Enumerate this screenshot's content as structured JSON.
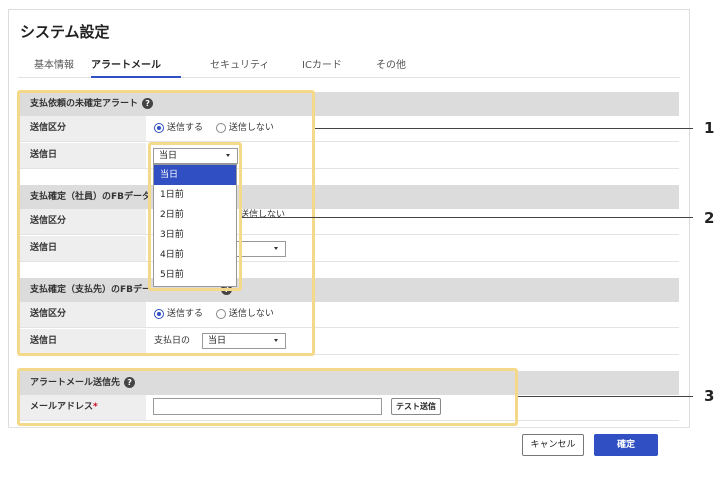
{
  "title": "システム設定",
  "tabs": [
    "基本情報",
    "アラートメール",
    "セキュリティ",
    "ICカード",
    "その他"
  ],
  "sections": {
    "s1": {
      "header": "支払依頼の未確定アラート",
      "send_type_label": "送信区分",
      "send_yes": "送信する",
      "send_no": "送信しない",
      "send_day_label": "送信日",
      "send_day_value": "当日"
    },
    "s2": {
      "header": "支払確定（社員）のFBデータ",
      "send_type_label": "送信区分",
      "send_no_partial": "送信しない",
      "send_day_label": "送信日"
    },
    "s3": {
      "header": "支払確定（支払先）のFBデー",
      "send_type_label": "送信区分",
      "send_yes": "送信する",
      "send_no": "送信しない",
      "send_day_label": "送信日",
      "day_prefix": "支払日の",
      "send_day_value": "当日"
    },
    "s4": {
      "header": "アラートメール送信先",
      "email_label": "メールアドレス",
      "required_mark": "*",
      "email_value": "",
      "test_button": "テスト送信"
    }
  },
  "dropdown_options": [
    "当日",
    "1日前",
    "2日前",
    "3日前",
    "4日前",
    "5日前"
  ],
  "footer": {
    "cancel": "キャンセル",
    "confirm": "確定"
  },
  "callouts": [
    "1",
    "2",
    "3"
  ],
  "colors": {
    "accent": "#2f4fc2",
    "highlight": "#f5d98a",
    "section_header_bg": "#dcdcdc",
    "required": "#d0021b"
  },
  "icons": {
    "help": "help-icon",
    "dropdown": "chevron-down-icon"
  }
}
